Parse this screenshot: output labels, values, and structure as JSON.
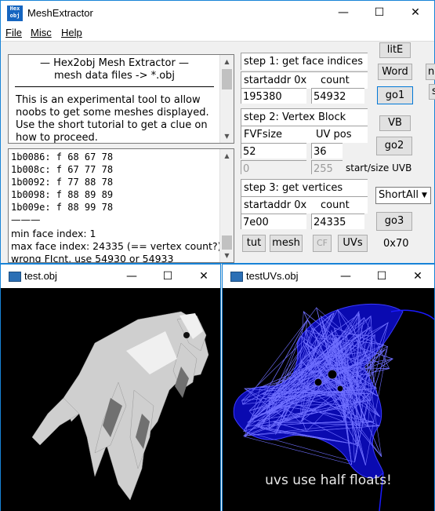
{
  "main_window": {
    "title": "MeshExtractor",
    "icon_text": "Hex obj",
    "controls": {
      "minimize": "—",
      "maximize": "☐",
      "close": "✕"
    }
  },
  "menu": [
    {
      "label": "File"
    },
    {
      "label": "Misc"
    },
    {
      "label": "Help"
    }
  ],
  "info_text": {
    "header1": "—   Hex2obj Mesh Extractor   —",
    "header2": "mesh data files -> *.obj",
    "body": "This is an experimental tool to allow noobs to get some meshes displayed. Use the short tutorial to get a clue on how to proceed."
  },
  "log": {
    "lines": [
      "1b0086: f  68 67 78",
      "1b008c: f  67 77 78",
      "1b0092: f  77 88 78",
      "1b0098: f  88 89 89",
      "1b009e: f  88 99 78",
      "———",
      "min face index: 1",
      "max face index: 24335 (== vertex count?)",
      "wrong FIcnt, use 54930 or 54933"
    ]
  },
  "step1": {
    "title": "step 1: get face indices",
    "start_label": "startaddr 0x",
    "count_label": "count",
    "start_value": "195380",
    "count_value": "54932",
    "go_label": "go1"
  },
  "step2": {
    "title": "step 2: Vertex Block",
    "fvf_label": "FVFsize",
    "uv_label": "UV pos",
    "fvf_value": "52",
    "uv_value": "36",
    "uvb_start": "0",
    "uvb_size": "255",
    "uvb_label": "start/size UVB",
    "go_label": "go2"
  },
  "step3": {
    "title": "step 3: get vertices",
    "start_label": "startaddr 0x",
    "count_label": "count",
    "start_value": "7e00",
    "count_value": "24335",
    "go_label": "go3"
  },
  "buttons": {
    "lite": "litE",
    "word": "Word",
    "vb": "VB",
    "tut": "tut",
    "mesh": "mesh",
    "cf": "CF",
    "uvs": "UVs",
    "cut_ne": "ne",
    "cut_s": "s"
  },
  "dropdown": {
    "selected": "ShortAll"
  },
  "hex_label": "0x70",
  "win_test": {
    "title": "test.obj"
  },
  "win_uvs": {
    "title": "testUVs.obj",
    "caption": "uvs use half floats!"
  },
  "colors": {
    "accent": "#0078d7",
    "uv_mesh": "#1a1aff",
    "model": "#d8d8d8"
  }
}
